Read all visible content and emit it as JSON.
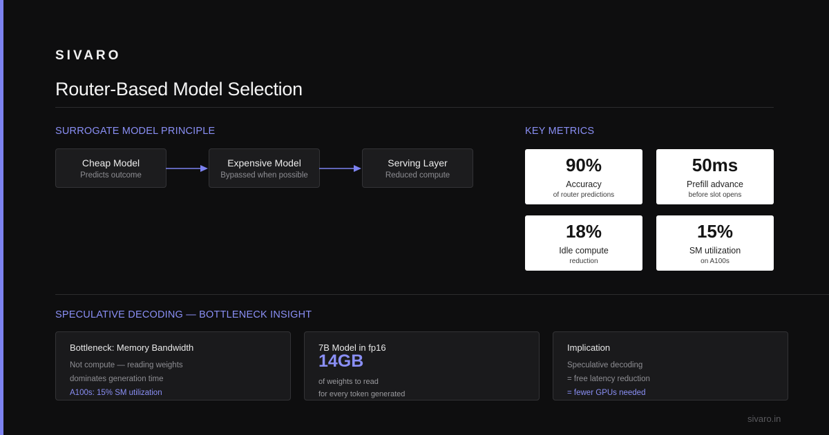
{
  "brand": "SIVARO",
  "title": "Router-Based Model Selection",
  "surrogate": {
    "label": "SURROGATE MODEL PRINCIPLE",
    "nodes": [
      {
        "title": "Cheap Model",
        "sub": "Predicts outcome"
      },
      {
        "title": "Expensive Model",
        "sub": "Bypassed when possible"
      },
      {
        "title": "Serving Layer",
        "sub": "Reduced compute"
      }
    ]
  },
  "metrics": {
    "label": "KEY METRICS",
    "items": [
      {
        "value": "90%",
        "label": "Accuracy",
        "sub": "of router predictions"
      },
      {
        "value": "50ms",
        "label": "Prefill advance",
        "sub": "before slot opens"
      },
      {
        "value": "18%",
        "label": "Idle compute",
        "sub": "reduction"
      },
      {
        "value": "15%",
        "label": "SM utilization",
        "sub": "on A100s"
      }
    ]
  },
  "speculative": {
    "label": "SPECULATIVE DECODING — BOTTLENECK INSIGHT",
    "cards": [
      {
        "title": "Bottleneck: Memory Bandwidth",
        "line1": "Not compute — reading weights",
        "line2": "dominates generation time",
        "accent": "A100s: 15% SM utilization"
      },
      {
        "title": "7B Model in fp16",
        "big": "14GB",
        "line1": "of weights to read",
        "line2": "for every token generated"
      },
      {
        "title": "Implication",
        "line1": "Speculative decoding",
        "line2": "= free latency reduction",
        "accent": "= fewer GPUs needed"
      }
    ]
  },
  "footer": {
    "url": "sivaro.in"
  },
  "colors": {
    "accent": "#7c82f0",
    "background": "#0e0e0f",
    "card": "#1c1c1e"
  }
}
